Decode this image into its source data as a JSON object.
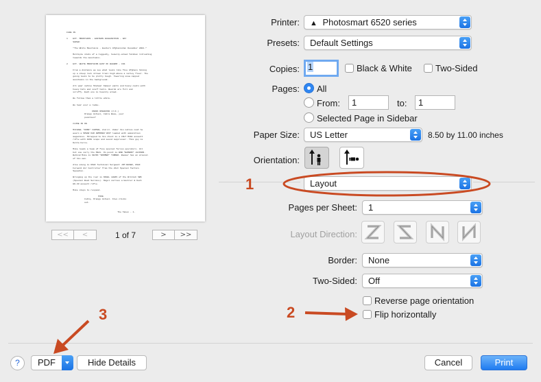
{
  "preview": {
    "lines": [
      "FADE IN",
      "",
      "1    EXT. MOUNTAINS - EASTERN AFGHANISTAN - DAY",
      "     SUPER:",
      "",
      "     \"The White Mountains - Eastern Afghanistan December 2001.\"",
      "",
      "     Multiple shots of a ruggedly, heavily-armed Taliban retreating",
      "     towards the mountains.",
      "",
      "2    EXT. WHITE MOUNTAINS EAST OF BAGRAM - CAS",
      "",
      "     From a distance we see what looks like five Afghans hiking",
      "     up a steep rock strewn trail high above a valley floor. The",
      "     going looks to be pretty tough. Towering snow capped",
      "     mountains in the background.",
      "",
      "     All wear native Shalwar Kameez pants and heavy coats with",
      "     heavy hats and scarf tails. Beards are full and",
      "     scruffy. Each one is heavily armed.",
      "",
      "     We follow them a little while.",
      "",
      "     We hear over a radio.",
      "",
      "                    KNOCK OPERATOR (V.O.)",
      "              Orange Actual, Cobra Base, your",
      "              position?",
      "",
      "     CLOSE IN ON",
      "",
      "     MICHAEL \"DOPE\" CARTER, 2nd Lt. Under his native coat he",
      "     wears a SPEAR KAR ARMORED VEST loaded with ammunition",
      "     magazines. Strapped to his chest is a COLT M4A1 assault",
      "     rifle with ACOG scope and sound suppressor. This guy is",
      "     Delta Force.",
      "",
      "     Mike leads a team of five special forces operators. All",
      "     but one carry the M4A1. On point is BOB \"BAMBOO\" JACKSON.",
      "     Behind Mike is KEVIN \"BOOMER\" TURNER. Boomer has an arsenal",
      "     of his own.",
      "",
      "     Also along is USAF Technical Sergeant JIM BAKER, USAF",
      "     Forward Air Controller from the 21st Special Tactics",
      "     Squadron.",
      "",
      "     Bringing up the rear is NIGEL LEWIS of the British SBS",
      "     (Special Boat Service). Nigel carries a Heckler & Koch",
      "     HK-33 assault rifle.",
      "",
      "     Mike stops to respond.",
      "",
      "                         MIKE",
      "              Cobra, Orange Actual. Five clicks",
      "              out.",
      "",
      "",
      "                                        The Taken - 1."
    ],
    "nav": {
      "first": "<<",
      "prev": "<",
      "next": ">",
      "last": ">>"
    },
    "page_count": "1 of 7"
  },
  "printer": {
    "label": "Printer:",
    "value": "Photosmart 6520 series",
    "icon": "warning-triangle-icon"
  },
  "presets": {
    "label": "Presets:",
    "value": "Default Settings"
  },
  "copies": {
    "label": "Copies:",
    "value": "1",
    "bw_label": "Black & White",
    "bw_checked": false,
    "two_sided_label": "Two-Sided",
    "two_sided_checked": false
  },
  "pages": {
    "label": "Pages:",
    "all_label": "All",
    "all_selected": true,
    "from_label": "From:",
    "from_value": "1",
    "to_label": "to:",
    "to_value": "1",
    "selected_label": "Selected Page in Sidebar"
  },
  "paper_size": {
    "label": "Paper Size:",
    "value": "US Letter",
    "dimensions": "8.50 by 11.00 inches"
  },
  "orientation": {
    "label": "Orientation:",
    "selected": "portrait"
  },
  "section_popup": {
    "value": "Layout"
  },
  "layout": {
    "pages_per_sheet_label": "Pages per Sheet:",
    "pages_per_sheet": "1",
    "direction_label": "Layout Direction:",
    "border_label": "Border:",
    "border": "None",
    "two_sided_label": "Two-Sided:",
    "two_sided": "Off",
    "reverse_label": "Reverse page orientation",
    "reverse_checked": false,
    "flip_label": "Flip horizontally",
    "flip_checked": false
  },
  "footer": {
    "help": "?",
    "pdf": "PDF",
    "hide_details": "Hide Details",
    "cancel": "Cancel",
    "print": "Print"
  },
  "annotations": {
    "one": "1",
    "two": "2",
    "three": "3",
    "color": "#c94a22"
  },
  "colors": {
    "accent": "#1f7bf0",
    "annotation": "#c94a22",
    "window_bg": "#ececec"
  }
}
